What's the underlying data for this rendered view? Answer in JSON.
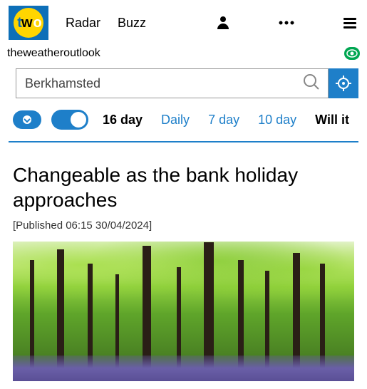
{
  "brand": {
    "name": "two",
    "subtitle": "theweatheroutlook"
  },
  "nav": {
    "radar": "Radar",
    "buzz": "Buzz"
  },
  "search": {
    "value": "Berkhamsted"
  },
  "tabs": {
    "active": "16 day",
    "items": [
      "16 day",
      "Daily",
      "7 day",
      "10 day",
      "Will it"
    ]
  },
  "article": {
    "title": "Changeable as the bank holiday approaches",
    "published_label": "[Published 06:15 30/04/2024]"
  },
  "colors": {
    "accent": "#1e7fc9",
    "green": "#00a651"
  }
}
